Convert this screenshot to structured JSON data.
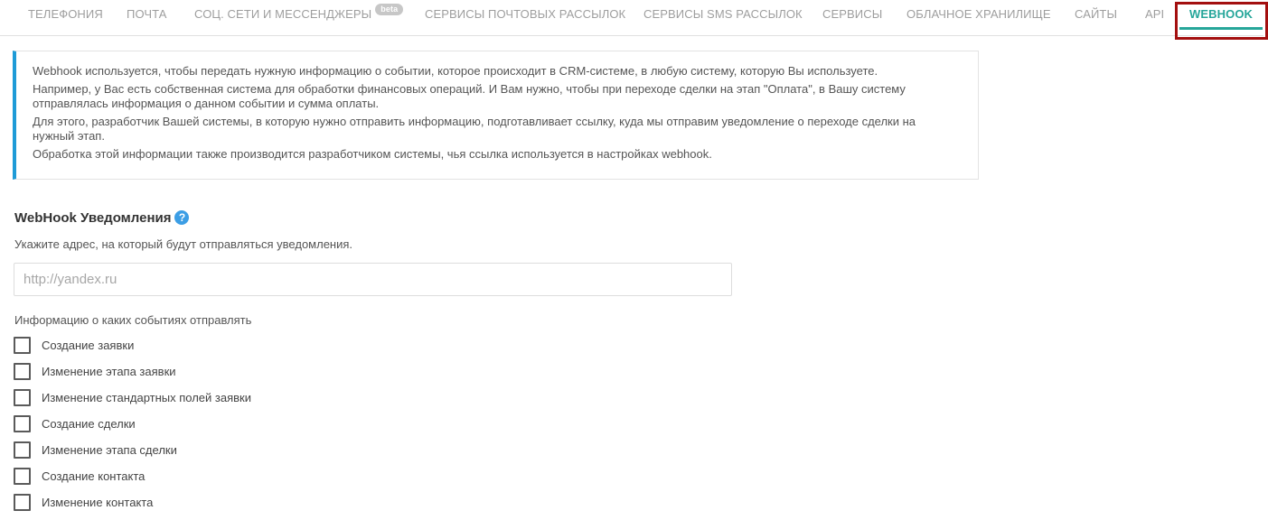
{
  "tabs": [
    {
      "label": "ТЕЛЕФОНИЯ"
    },
    {
      "label": "ПОЧТА"
    },
    {
      "label": "СОЦ. СЕТИ И МЕССЕНДЖЕРЫ",
      "badge": "beta"
    },
    {
      "label": "СЕРВИСЫ ПОЧТОВЫХ РАССЫЛОК"
    },
    {
      "label": "СЕРВИСЫ SMS РАССЫЛОК"
    },
    {
      "label": "СЕРВИСЫ"
    },
    {
      "label": "ОБЛАЧНОЕ ХРАНИЛИЩЕ"
    },
    {
      "label": "САЙТЫ"
    },
    {
      "label": "API"
    },
    {
      "label": "WEBHOOK",
      "active": true
    }
  ],
  "info": {
    "lines": [
      "Webhook используется, чтобы передать нужную информацию о событии, которое происходит в CRM-системе, в любую систему, которую Вы используете.",
      "Например, у Вас есть собственная система для обработки финансовых операций. И Вам нужно, чтобы при переходе сделки на этап \"Оплата\", в Вашу систему отправлялась информация о данном событии и сумма оплаты.",
      "Для этого, разработчик Вашей системы, в которую нужно отправить информацию, подготавливает ссылку, куда мы отправим уведомление о переходе сделки на нужный этап.",
      "Обработка этой информации также производится разработчиком системы, чья ссылка используется в настройках webhook."
    ]
  },
  "webhook": {
    "title": "WebHook Уведомления",
    "help_icon": "?",
    "hint": "Укажите адрес, на который будут отправляться уведомления.",
    "url_value": "",
    "url_placeholder": "http://yandex.ru",
    "events_label": "Информацию о каких событиях отправлять",
    "events": [
      {
        "label": "Создание заявки",
        "checked": false
      },
      {
        "label": "Изменение этапа заявки",
        "checked": false
      },
      {
        "label": "Изменение стандартных полей заявки",
        "checked": false
      },
      {
        "label": "Создание сделки",
        "checked": false
      },
      {
        "label": "Изменение этапа сделки",
        "checked": false
      },
      {
        "label": "Создание контакта",
        "checked": false
      },
      {
        "label": "Изменение контакта",
        "checked": false
      }
    ]
  },
  "colors": {
    "accent": "#26a69a",
    "info_border": "#1e9bd7",
    "highlight": "#a30f0f",
    "help_icon": "#3c9ee5"
  }
}
